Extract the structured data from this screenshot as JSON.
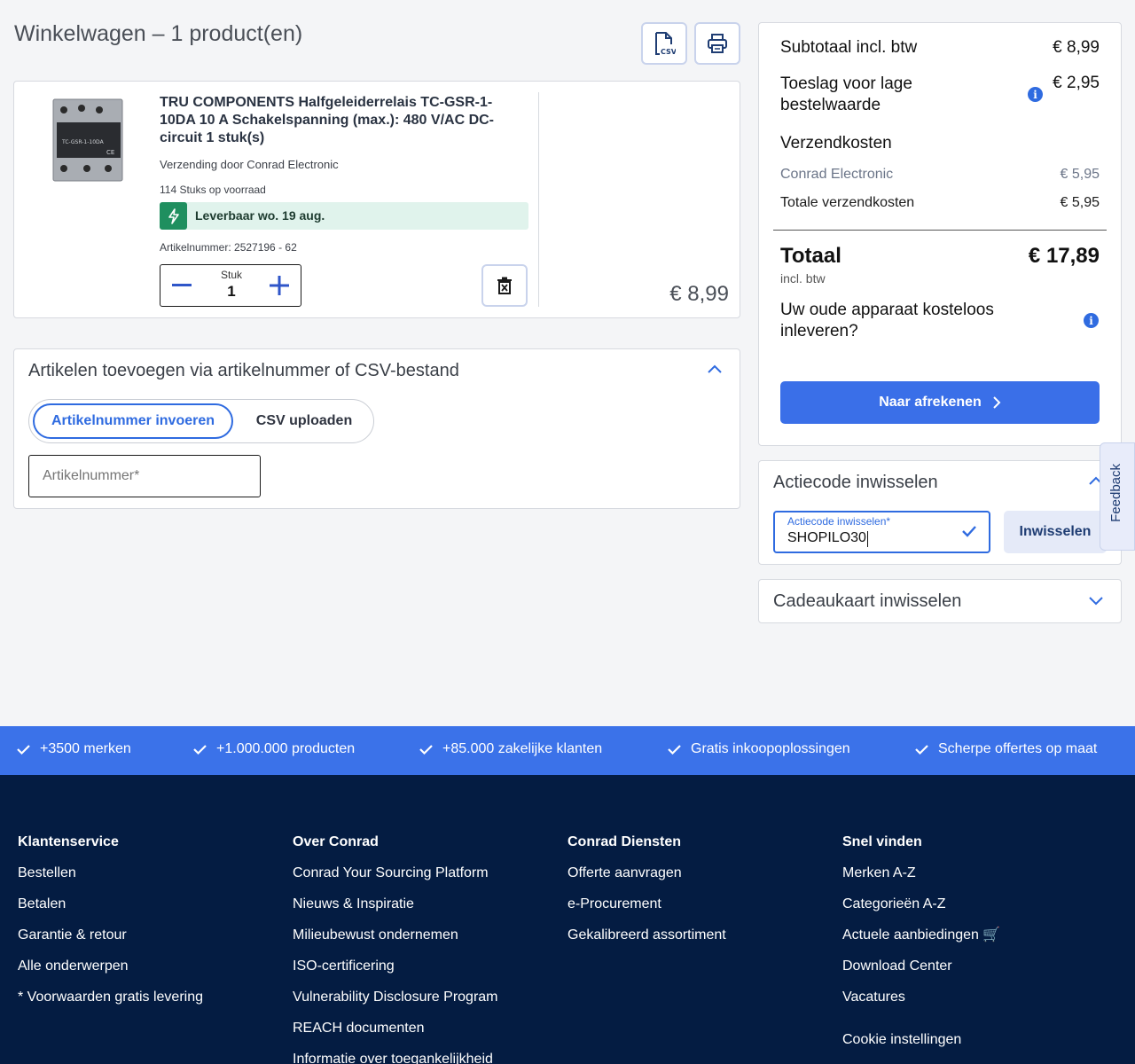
{
  "header": {
    "title": "Winkelwagen – 1 product(en)",
    "csv_icon": "csv-export-icon",
    "print_icon": "printer-icon"
  },
  "product": {
    "title": "TRU COMPONENTS Halfgeleiderrelais TC-GSR-1-10DA 10 A Schakelspanning (max.): 480 V/AC DC-circuit 1 stuk(s)",
    "shipping": "Verzending door Conrad Electronic",
    "stock": "114 Stuks op voorraad",
    "availability": "Leverbaar wo. 19 aug.",
    "article_number": "Artikelnummer: 2527196 - 62",
    "qty_label": "Stuk",
    "qty_value": "1",
    "price": "€ 8,99",
    "relay_label": "TC-GSR-1-10DA"
  },
  "add_articles": {
    "title": "Artikelen toevoegen via artikelnummer of CSV-bestand",
    "tab_active": "Artikelnummer invoeren",
    "tab_inactive": "CSV uploaden",
    "input_placeholder": "Artikelnummer*"
  },
  "summary": {
    "subtotal_label": "Subtotaal incl. btw",
    "subtotal_value": "€ 8,99",
    "surcharge_label": "Toeslag voor lage bestelwaarde",
    "surcharge_value": "€ 2,95",
    "shipping_heading": "Verzendkosten",
    "shipping_provider": "Conrad Electronic",
    "shipping_provider_value": "€ 5,95",
    "shipping_total_label": "Totale verzendkosten",
    "shipping_total_value": "€ 5,95",
    "total_label": "Totaal",
    "total_value": "€ 17,89",
    "incl_btw": "incl. btw",
    "return_text": "Uw oude apparaat kosteloos inleveren?",
    "checkout_label": "Naar afrekenen"
  },
  "promo": {
    "title": "Actiecode inwisselen",
    "field_label": "Actiecode inwisselen*",
    "field_value": "SHOPILO30",
    "button_label": "Inwisselen"
  },
  "feedback": {
    "label": "Feedback"
  },
  "gift": {
    "title": "Cadeaukaart inwisselen"
  },
  "usp": [
    "+3500 merken",
    "+1.000.000 producten",
    "+85.000 zakelijke klanten",
    "Gratis inkoopoplossingen",
    "Scherpe offertes op maat"
  ],
  "footer": {
    "col1": {
      "heading": "Klantenservice",
      "links": [
        "Bestellen",
        "Betalen",
        "Garantie & retour",
        "Alle onderwerpen",
        "* Voorwaarden gratis levering"
      ]
    },
    "col2": {
      "heading": "Over Conrad",
      "links": [
        "Conrad Your Sourcing Platform",
        "Nieuws & Inspiratie",
        "Milieubewust ondernemen",
        "ISO-certificering",
        "Vulnerability Disclosure Program",
        "REACH documenten",
        "Informatie over toegankelijkheid"
      ]
    },
    "col3": {
      "heading": "Conrad Diensten",
      "links": [
        "Offerte aanvragen",
        "e-Procurement",
        "Gekalibreerd assortiment"
      ]
    },
    "col4": {
      "heading": "Snel vinden",
      "links": [
        "Merken A-Z",
        "Categorieën A-Z",
        "Actuele aanbiedingen 🛒",
        "Download Center",
        "Vacatures"
      ],
      "cookie": "Cookie instellingen"
    }
  },
  "colors": {
    "accent": "#3a6fe8",
    "footer_bg": "#041c42",
    "availability_green": "#1f8f5f"
  }
}
